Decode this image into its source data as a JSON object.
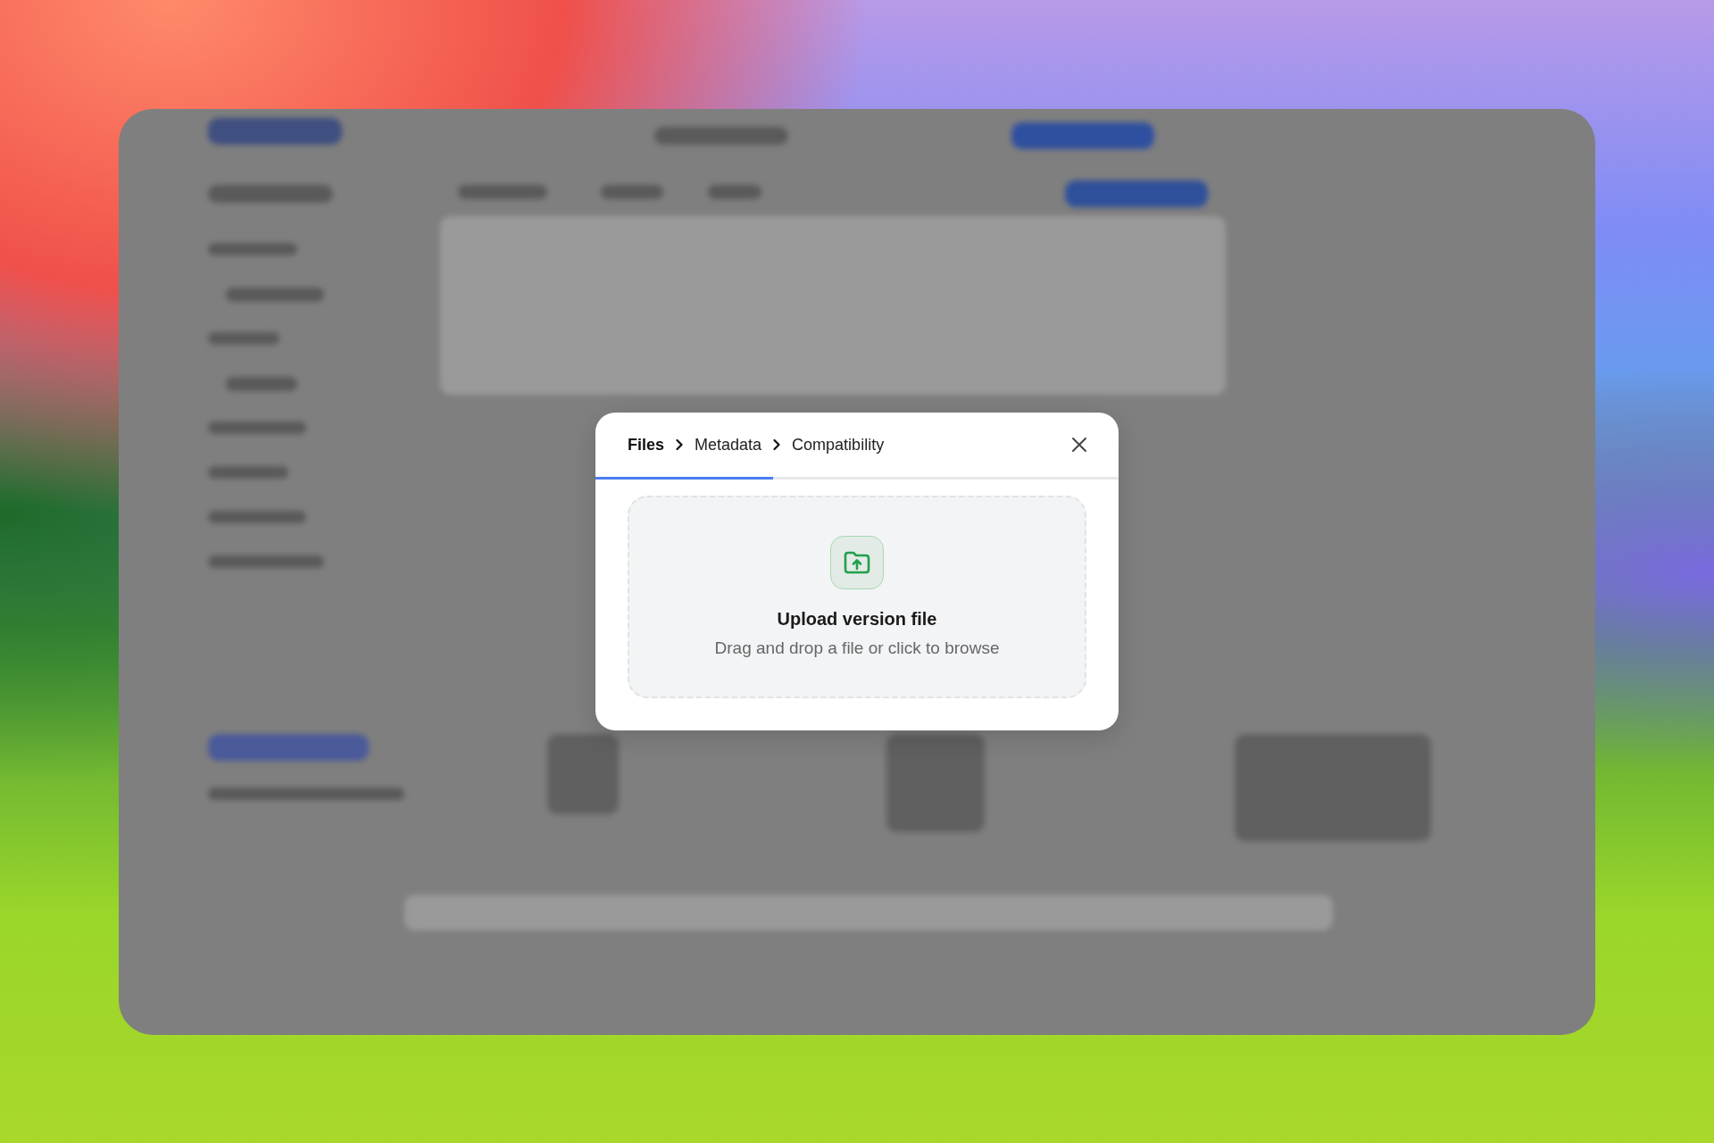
{
  "breadcrumb": [
    {
      "label": "Files",
      "selected": true
    },
    {
      "label": "Metadata",
      "selected": false
    },
    {
      "label": "Compatibility",
      "selected": false
    }
  ],
  "progress": {
    "level": 0.34
  },
  "dropzone": {
    "title": "Upload version file",
    "subtitle": "Drag and drop a file or click to browse"
  }
}
